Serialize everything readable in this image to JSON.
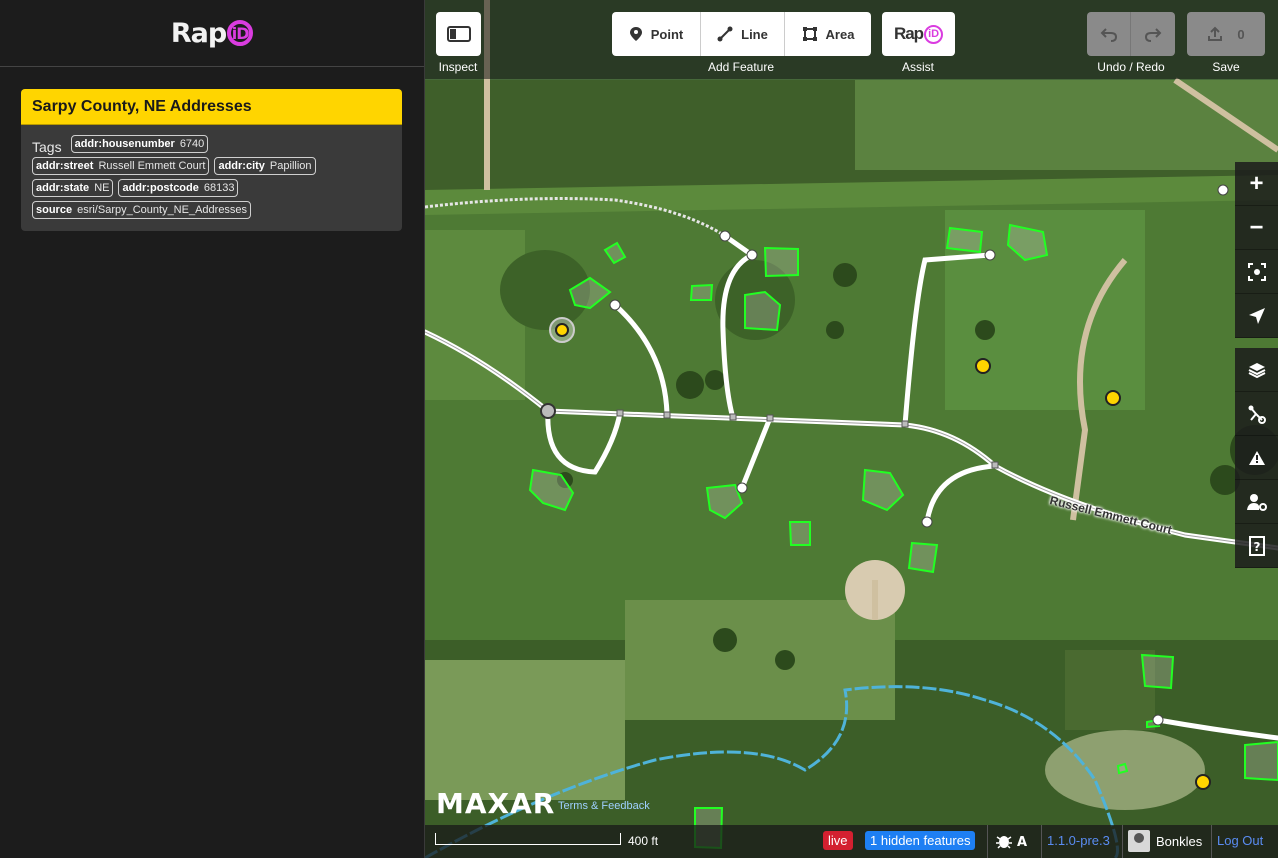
{
  "sidebar": {
    "logo_text": "Rap",
    "logo_accent": "iD",
    "feature_title": "Sarpy County, NE Addresses",
    "tags_label": "Tags",
    "tags": [
      {
        "key": "addr:housenumber",
        "value": "6740"
      },
      {
        "key": "addr:street",
        "value": "Russell Emmett Court"
      },
      {
        "key": "addr:city",
        "value": "Papillion"
      },
      {
        "key": "addr:state",
        "value": "NE"
      },
      {
        "key": "addr:postcode",
        "value": "68133"
      },
      {
        "key": "source",
        "value": "esri/Sarpy_County_NE_Addresses"
      }
    ]
  },
  "toolbar": {
    "inspect_label": "Inspect",
    "point_label": "Point",
    "line_label": "Line",
    "area_label": "Area",
    "add_feature_label": "Add Feature",
    "assist_logo": "Rap",
    "assist_logo_accent": "iD",
    "assist_label": "Assist",
    "undo_redo_label": "Undo / Redo",
    "save_label": "Save",
    "save_count": "0"
  },
  "map": {
    "street_name": "Russell Emmett Court",
    "imagery_provider": "MAXAR",
    "terms_link": "Terms & Feedback"
  },
  "footer": {
    "scale_label": "400 ft",
    "live_badge": "live",
    "hidden_features": "1 hidden features",
    "issues_icon": "bug-icon",
    "version": "1.1.0-pre.3",
    "username": "Bonkles",
    "logout": "Log Out"
  },
  "colors": {
    "accent": "#ffd500",
    "rapid_magenta": "#da3ce0",
    "building_green": "#22ff22",
    "address_point": "#ffd500",
    "live_red": "#d32030",
    "hidden_blue": "#1e7ff3",
    "link_blue": "#5a8cf2"
  }
}
